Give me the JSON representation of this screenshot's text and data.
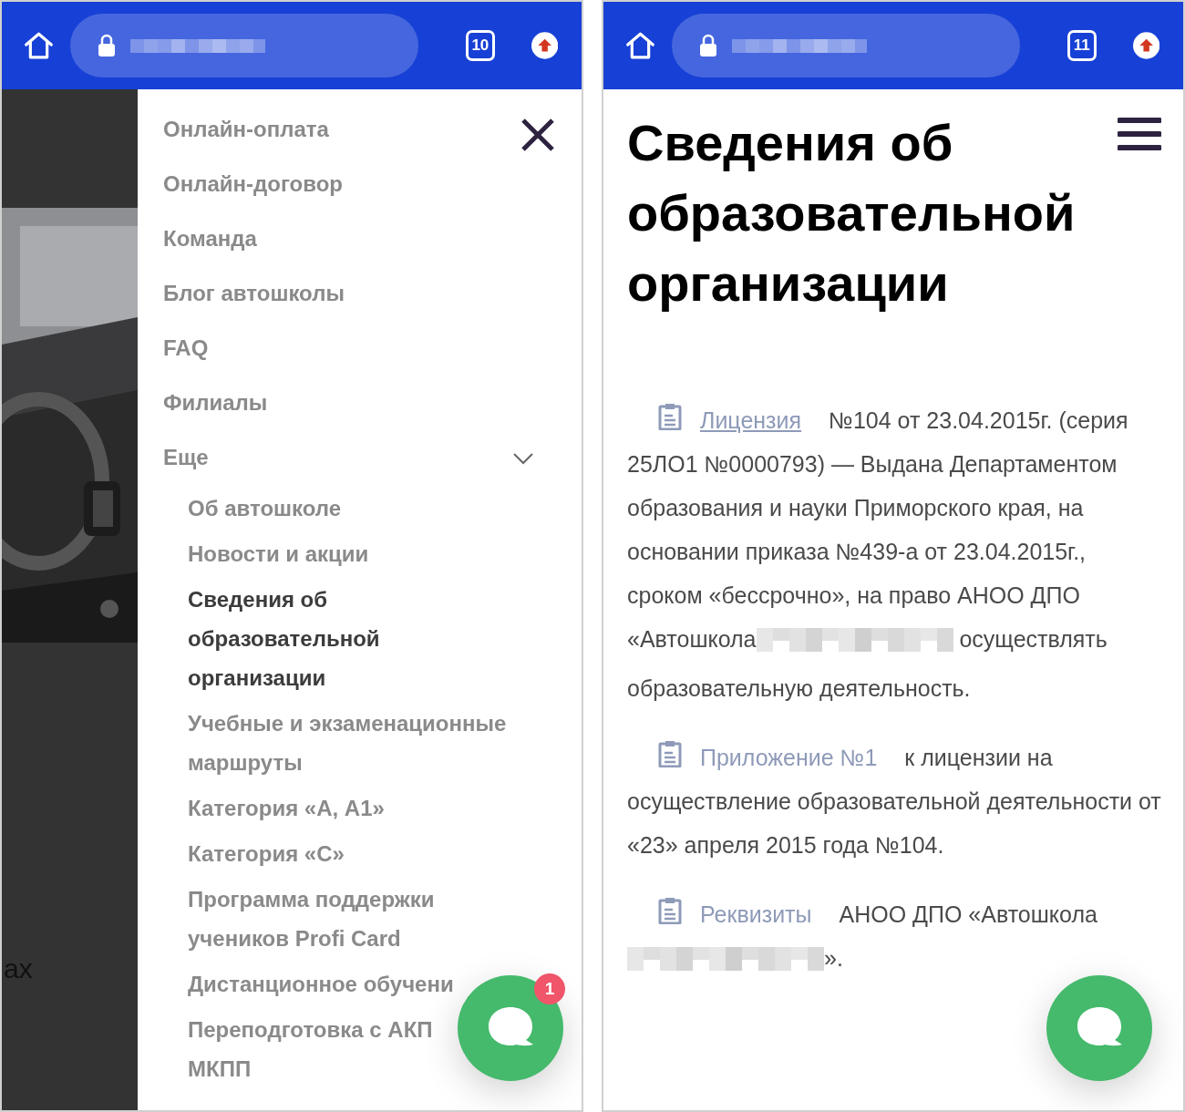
{
  "left_screen": {
    "browser_bar": {
      "tab_count": "10"
    },
    "backdrop": {
      "text": "ах"
    },
    "menu": {
      "items": [
        {
          "label": "Онлайн-оплата"
        },
        {
          "label": "Онлайн-договор"
        },
        {
          "label": "Команда"
        },
        {
          "label": "Блог автошколы"
        },
        {
          "label": "FAQ"
        },
        {
          "label": "Филиалы"
        },
        {
          "label": "Еще",
          "expanded": true,
          "children": [
            {
              "lines": [
                "Об автошколе"
              ],
              "selected": false
            },
            {
              "lines": [
                "Новости и акции"
              ],
              "selected": false
            },
            {
              "lines": [
                "Сведения об",
                "образовательной",
                "организации"
              ],
              "selected": true
            },
            {
              "lines": [
                "Учебные и экзаменационные",
                "маршруты"
              ],
              "selected": false
            },
            {
              "lines": [
                "Категория «А, А1»"
              ],
              "selected": false
            },
            {
              "lines": [
                "Категория «С»"
              ],
              "selected": false
            },
            {
              "lines": [
                "Программа поддержки",
                "учеников Profi Card"
              ],
              "selected": false
            },
            {
              "lines": [
                "Дистанционное обучени"
              ],
              "selected": false
            },
            {
              "lines": [
                "Переподготовка с АКП",
                "МКПП"
              ],
              "selected": false
            }
          ]
        }
      ]
    },
    "chat": {
      "badge": "1"
    }
  },
  "right_screen": {
    "browser_bar": {
      "tab_count": "11"
    },
    "title": "Сведения об образовательной организации",
    "documents": [
      {
        "link": "Лицензия",
        "underlined": true,
        "parts": [
          {
            "kind": "text",
            "text": "№104 от 23.04.2015г. (серия 25ЛО1 №0000793) — Выдана Департаментом образования и науки Приморского края, на основании приказа №439-а от 23.04.2015г., сроком «бессрочно», на право АНОО ДПО «Автошкола"
          },
          {
            "kind": "redacted"
          },
          {
            "kind": "text",
            "text": " осуществлять образовательную деятельность."
          }
        ]
      },
      {
        "link": "Приложение №1",
        "underlined": false,
        "parts": [
          {
            "kind": "text",
            "text": "к лицензии на осуществление образовательной деятельности от «23» апреля 2015 года №104."
          }
        ]
      },
      {
        "link": "Реквизиты",
        "underlined": false,
        "parts": [
          {
            "kind": "text",
            "text": "АНОО ДПО «Автошкола"
          },
          {
            "kind": "redacted"
          },
          {
            "kind": "text",
            "text": "»."
          }
        ]
      }
    ]
  }
}
